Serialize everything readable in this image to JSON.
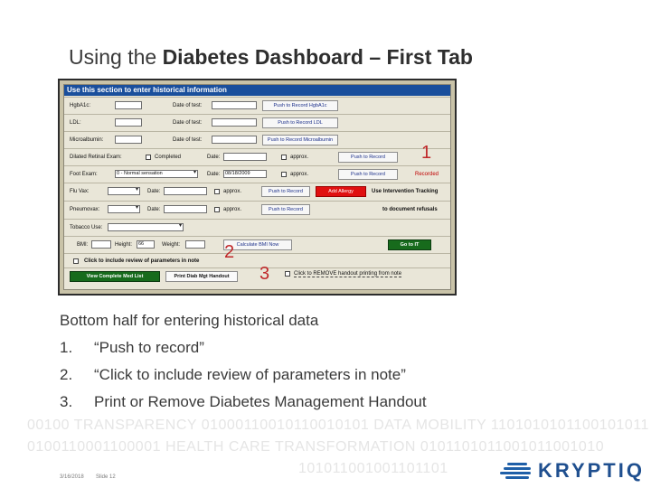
{
  "slide": {
    "title_prefix": "Using the ",
    "title_bold": "Diabetes Dashboard – First Tab",
    "date": "3/16/2018",
    "slide_num": "Slide 12",
    "logo": "KRYPTIQ"
  },
  "panel": {
    "header": "Use this section to enter historical information",
    "hgb_label": "HgbA1c:",
    "ldl_label": "LDL:",
    "micro_label": "Microalbumin:",
    "date_label": "Date of test:",
    "push_hgb": "Push to Record HgbA1c",
    "push_ldl": "Push to Record LDL",
    "push_micro": "Push to Record Microalbumin",
    "dre_label": "Dilated Retinal Exam:",
    "completed_label": "Completed",
    "date_short": "Date:",
    "approx_label": "approx.",
    "push_to_record": "Push to Record",
    "recorded": "Recorded",
    "foot_label": "Foot Exam:",
    "foot_value": "0 - Normal sensation",
    "foot_date": "08/18/2009",
    "flu_label": "Flu Vax:",
    "add_allergy": "Add Allergy",
    "pneumo_label": "Pneumovax:",
    "intervention_line1": "Use Intervention Tracking",
    "intervention_line2": "to document refusals",
    "tobacco_label": "Tobacco Use:",
    "bmi_label": "BMI:",
    "height_label": "Height:",
    "height_value": "66",
    "weight_label": "Weight:",
    "calc_bmi": "Calculate BMI Now",
    "go_to_it": "Go to IT",
    "include_review": "Click to include review of parameters in note",
    "view_med_list": "View Complete Med List",
    "print_handout": "Print Diab Mgt Handout",
    "remove_handout": "Click to REMOVE handout printing from note"
  },
  "callouts": {
    "c1": "1",
    "c2": "2",
    "c3": "3"
  },
  "body": {
    "heading": "Bottom half for entering historical data",
    "items": [
      {
        "num": "1.",
        "text": "“Push to record”"
      },
      {
        "num": "2.",
        "text": "“Click to include review of parameters in note”"
      },
      {
        "num": "3.",
        "text": "Print or Remove Diabetes Management Handout"
      }
    ]
  },
  "watermark": {
    "line1": "00100 TRANSPARENCY 01000110010110010101 DATA MOBILITY 1101010101100101011",
    "line2": "0100110001100001 HEALTH CARE TRANSFORMATION 0101101011001011001010",
    "line3": "101011001001101101"
  },
  "colors": {
    "accent_red": "#c0282a",
    "header_blue": "#1a4f9c",
    "logo_blue": "#1f4f8f"
  }
}
